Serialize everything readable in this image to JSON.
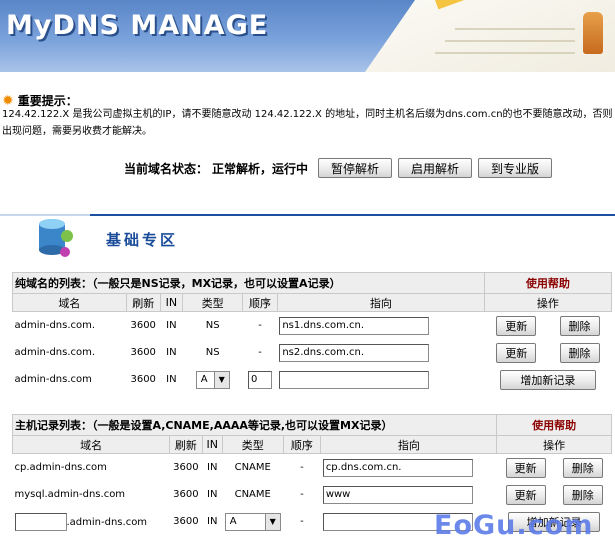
{
  "banner": {
    "title": "MyDNS  MANAGE"
  },
  "notice": {
    "heading": "重要提示：",
    "text": "124.42.122.X 是我公司虚拟主机的IP，请不要随意改动 124.42.122.X 的地址，同时主机名后缀为dns.com.cn的也不要随意改动，否则出现问题，需要另收费才能解决。"
  },
  "status": {
    "label": "当前域名状态：",
    "value": "正常解析，运行中",
    "buttons": [
      "暂停解析",
      "启用解析",
      "到专业版"
    ]
  },
  "zone": {
    "title": "基础专区"
  },
  "pure_domain": {
    "title": "纯域名的列表：（一般只是NS记录，MX记录，也可以设置A记录）",
    "help": "使用帮助",
    "headers": [
      "域名",
      "刷新",
      "IN",
      "类型",
      "顺序",
      "指向",
      "操作"
    ],
    "rows": [
      {
        "domain": "admin-dns.com.",
        "ttl": "3600",
        "in": "IN",
        "type": "NS",
        "order": "-",
        "target": "ns1.dns.com.cn.",
        "btn1": "更新",
        "btn2": "删除"
      },
      {
        "domain": "admin-dns.com.",
        "ttl": "3600",
        "in": "IN",
        "type": "NS",
        "order": "-",
        "target": "ns2.dns.com.cn.",
        "btn1": "更新",
        "btn2": "删除"
      }
    ],
    "new_row": {
      "domain": "admin-dns.com",
      "ttl": "3600",
      "in": "IN",
      "type": "A",
      "order": "0",
      "target": "",
      "btn": "增加新记录"
    }
  },
  "host_records": {
    "title": "主机记录列表：（一般是设置A,CNAME,AAAA等记录,也可以设置MX记录）",
    "help": "使用帮助",
    "headers": [
      "域名",
      "刷新",
      "IN",
      "类型",
      "顺序",
      "指向",
      "操作"
    ],
    "rows": [
      {
        "domain": "cp.admin-dns.com",
        "ttl": "3600",
        "in": "IN",
        "type": "CNAME",
        "order": "-",
        "target": "cp.dns.com.cn.",
        "btn1": "更新",
        "btn2": "删除"
      },
      {
        "domain": "mysql.admin-dns.com",
        "ttl": "3600",
        "in": "IN",
        "type": "CNAME",
        "order": "-",
        "target": "www",
        "btn1": "更新",
        "btn2": "删除"
      }
    ],
    "new_row": {
      "host": "",
      "suffix": ".admin-dns.com",
      "ttl": "3600",
      "in": "IN",
      "type": "A",
      "order": "-",
      "target": "",
      "btn": "增加新记录"
    }
  },
  "watermark": "EoGu.com"
}
